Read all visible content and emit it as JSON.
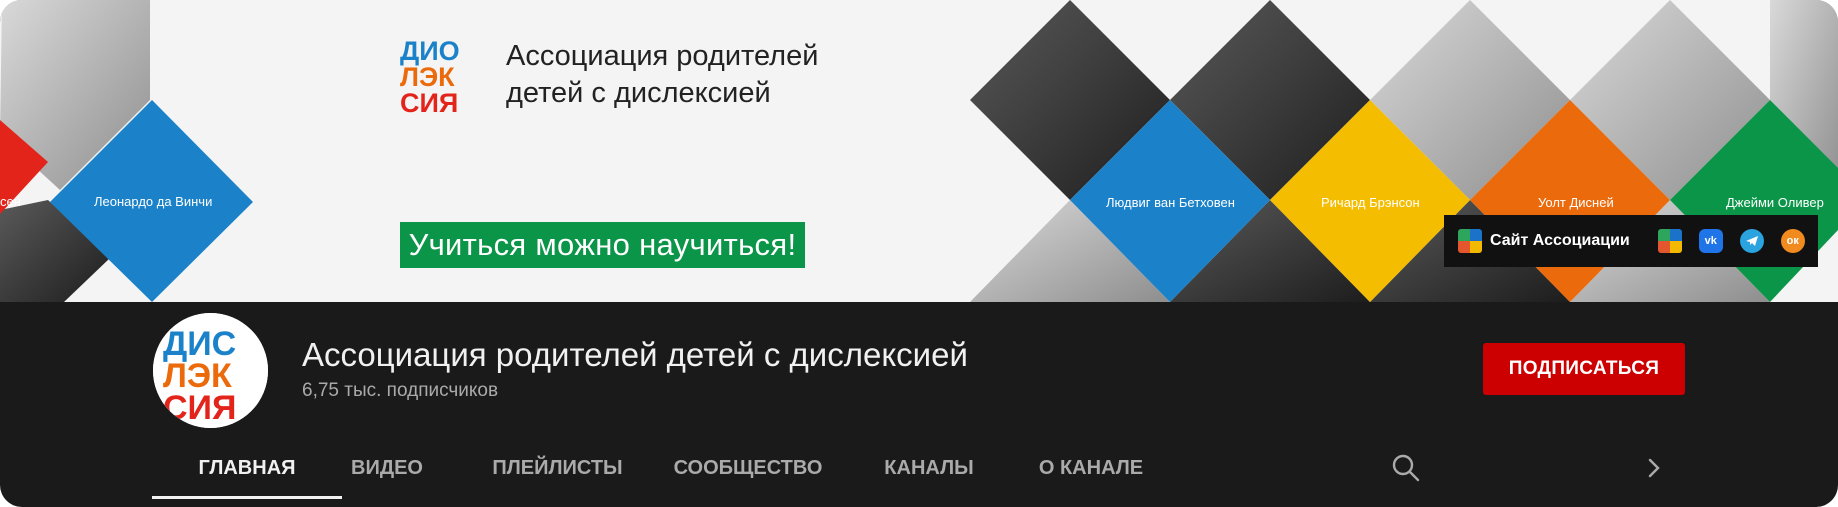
{
  "banner": {
    "logo_alt": "ДИСЛЕКСИЯ",
    "title_line1": "Ассоциация родителей",
    "title_line2": "детей с дислексией",
    "slogan": "Учиться можно научиться!",
    "portraits": {
      "left_clip": "сен",
      "leonardo": "Леонардо да Винчи",
      "beethoven": "Людвиг ван Бетховен",
      "branson": "Ричард Брэнсон",
      "disney": "Уолт Дисней",
      "oliver": "Джейми Оливер"
    },
    "links": {
      "site_label": "Сайт Ассоциации",
      "social_icons": [
        "site-icon",
        "vk-icon",
        "telegram-icon",
        "odnoklassniki-icon"
      ]
    },
    "colors": {
      "blue": "#1b82c9",
      "red": "#e3241b",
      "yellow": "#f5bd00",
      "orange": "#ea6a0c",
      "green": "#0b9548"
    }
  },
  "channel": {
    "name": "Ассоциация родителей детей с дислексией",
    "subscribers": "6,75 тыс. подписчиков",
    "subscribe_label": "ПОДПИСАТЬСЯ"
  },
  "tabs": [
    {
      "label": "ГЛАВНАЯ",
      "active": true
    },
    {
      "label": "ВИДЕО"
    },
    {
      "label": "ПЛЕЙЛИСТЫ"
    },
    {
      "label": "СООБЩЕСТВО"
    },
    {
      "label": "КАНАЛЫ"
    },
    {
      "label": "О КАНАЛЕ"
    }
  ]
}
